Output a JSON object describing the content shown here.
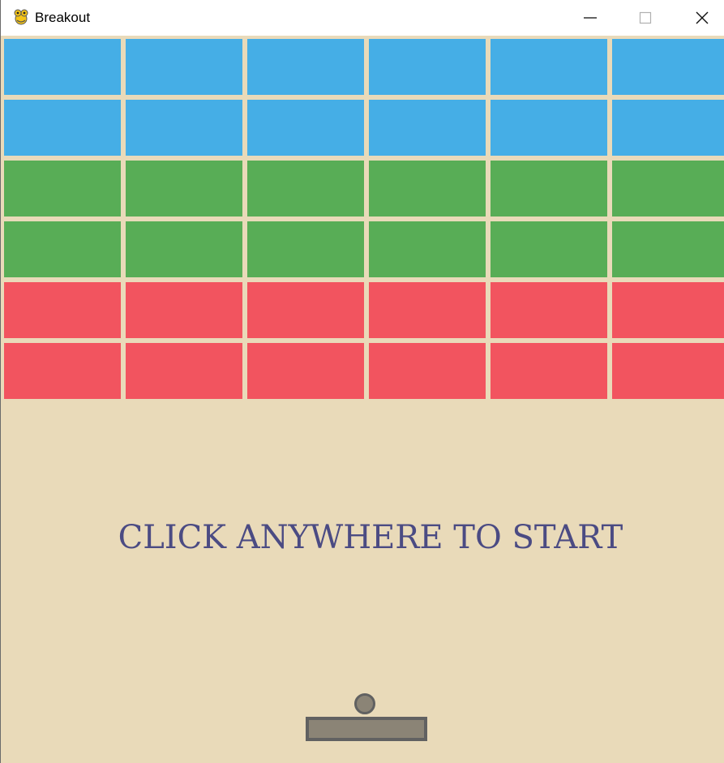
{
  "window": {
    "title": "Breakout",
    "icons": {
      "app": "pygame-snake-icon",
      "minimize": "minimize-icon",
      "maximize": "maximize-icon",
      "close": "close-icon"
    }
  },
  "game": {
    "message": "CLICK ANYWHERE TO START",
    "brick_colors": {
      "blue": "#45aee6",
      "green": "#58ad56",
      "red": "#f2545f"
    },
    "background_color": "#e9dab9",
    "message_color": "#4b4b83",
    "paddle_color": "#8b8476",
    "brick_rows": [
      "blue",
      "blue",
      "green",
      "green",
      "red",
      "red"
    ],
    "bricks_per_row": 6
  }
}
